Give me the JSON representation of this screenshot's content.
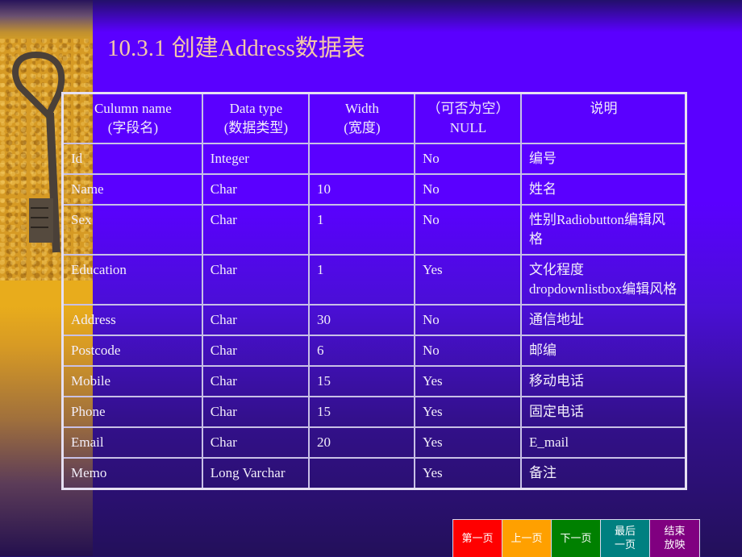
{
  "slide": {
    "title": "10.3.1 创建Address数据表"
  },
  "table": {
    "headers": [
      {
        "line1": "Culumn  name",
        "line2": "(字段名)"
      },
      {
        "line1": "Data type",
        "line2": "(数据类型)"
      },
      {
        "line1": "Width",
        "line2": "(宽度)"
      },
      {
        "line1": "（可否为空）",
        "line2": "NULL"
      },
      {
        "line1": "说明",
        "line2": ""
      }
    ],
    "rows": [
      {
        "name": "Id",
        "type": "Integer",
        "width": "",
        "nullable": "No",
        "desc": "编号"
      },
      {
        "name": "Name",
        "type": "Char",
        "width": "10",
        "nullable": "No",
        "desc": "姓名"
      },
      {
        "name": "Sex",
        "type": "Char",
        "width": "1",
        "nullable": "No",
        "desc": "性别Radiobutton编辑风格"
      },
      {
        "name": "Education",
        "type": "Char",
        "width": "1",
        "nullable": "Yes",
        "desc": "文化程度 dropdownlistbox编辑风格"
      },
      {
        "name": "Address",
        "type": "Char",
        "width": "30",
        "nullable": "No",
        "desc": "通信地址"
      },
      {
        "name": "Postcode",
        "type": "Char",
        "width": "6",
        "nullable": "No",
        "desc": "邮编"
      },
      {
        "name": "Mobile",
        "type": "Char",
        "width": "15",
        "nullable": "Yes",
        "desc": "移动电话"
      },
      {
        "name": "Phone",
        "type": "Char",
        "width": "15",
        "nullable": "Yes",
        "desc": "固定电话"
      },
      {
        "name": "Email",
        "type": "Char",
        "width": "20",
        "nullable": "Yes",
        "desc": "E_mail"
      },
      {
        "name": "Memo",
        "type": "Long  Varchar",
        "width": "",
        "nullable": "Yes",
        "desc": "备注"
      }
    ]
  },
  "navigation": {
    "buttons": [
      {
        "label": "第一页",
        "color": "#ff0000"
      },
      {
        "label": "上一页",
        "color": "#ffa000"
      },
      {
        "label": "下一页",
        "color": "#008000"
      },
      {
        "label": "最后一页",
        "color": "#008080"
      },
      {
        "label": "结束放映",
        "color": "#800080"
      }
    ]
  },
  "decoration": {
    "image": "key-icon"
  }
}
